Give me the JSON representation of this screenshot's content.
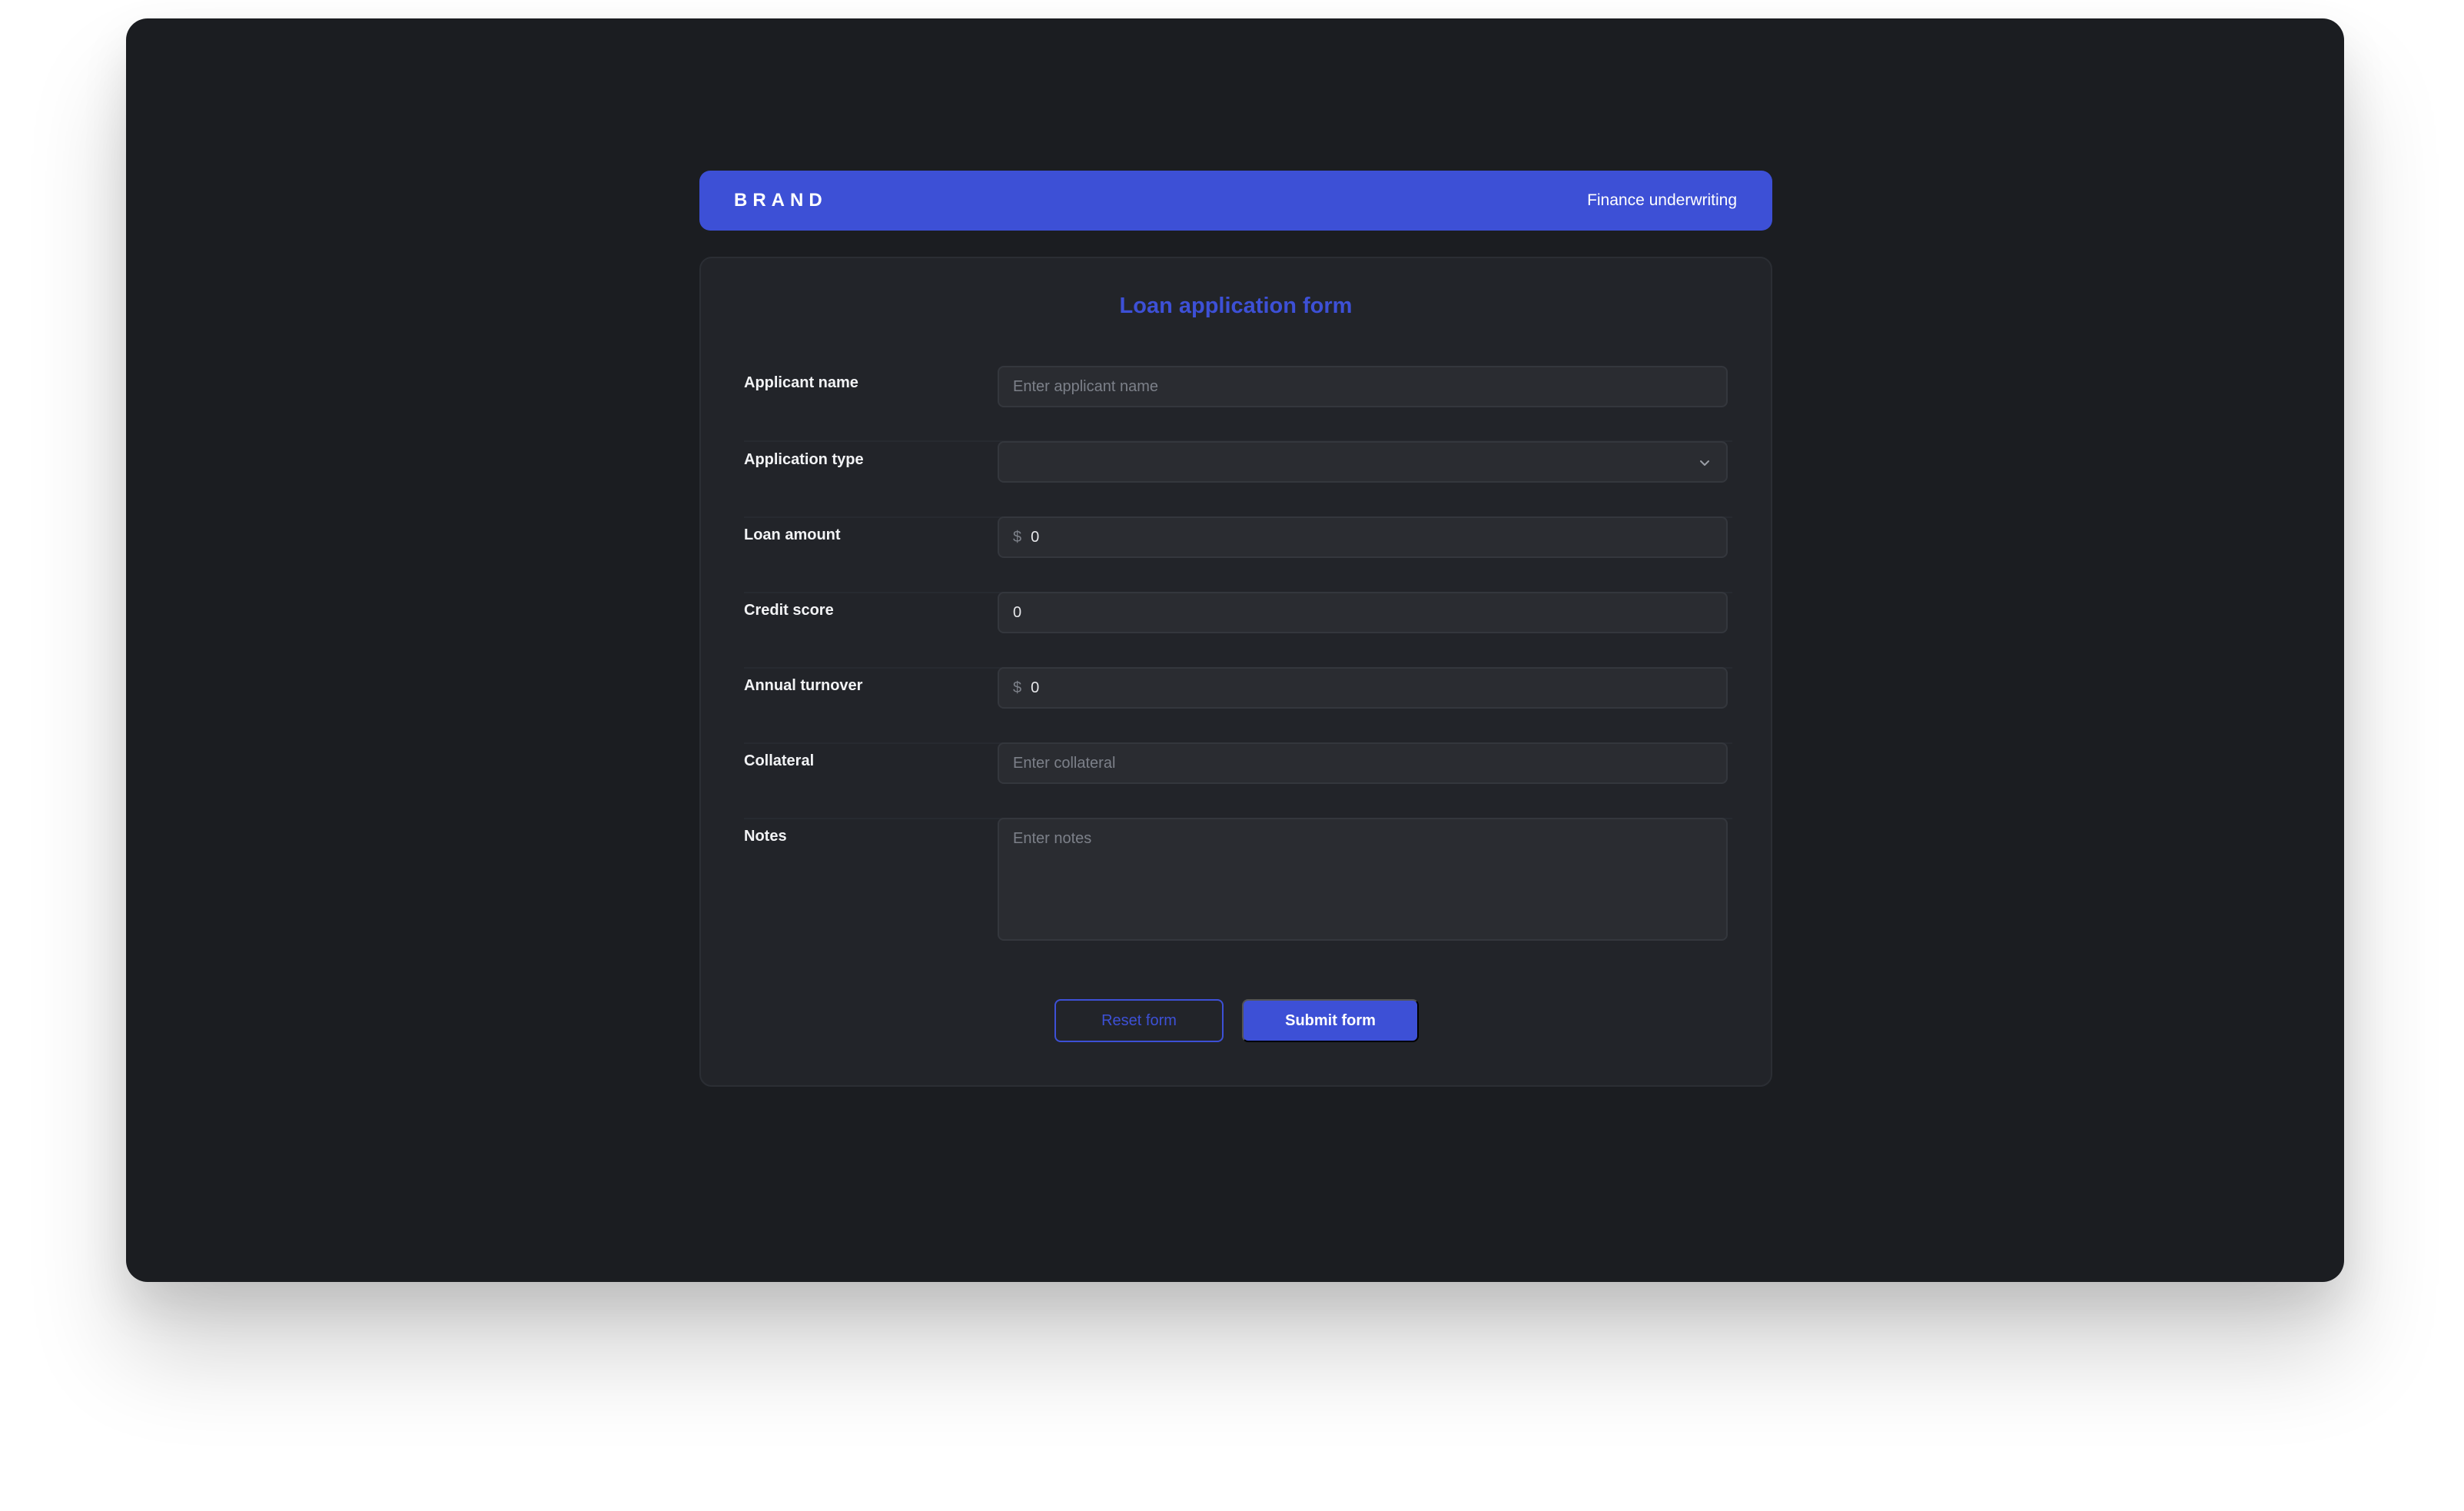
{
  "header": {
    "brand": "BRAND",
    "subtitle": "Finance underwriting"
  },
  "form": {
    "title": "Loan application form",
    "fields": {
      "applicant_name": {
        "label": "Applicant name",
        "placeholder": "Enter applicant name"
      },
      "application_type": {
        "label": "Application type",
        "value": ""
      },
      "loan_amount": {
        "label": "Loan amount",
        "prefix": "$",
        "value": "0"
      },
      "credit_score": {
        "label": "Credit score",
        "value": "0"
      },
      "annual_turnover": {
        "label": "Annual turnover",
        "prefix": "$",
        "value": "0"
      },
      "collateral": {
        "label": "Collateral",
        "placeholder": "Enter collateral"
      },
      "notes": {
        "label": "Notes",
        "placeholder": "Enter notes"
      }
    },
    "buttons": {
      "reset": "Reset form",
      "submit": "Submit form"
    }
  },
  "colors": {
    "accent": "#3d50d6",
    "window_bg": "#1b1d21",
    "card_bg": "#222429",
    "field_bg": "#2a2c31"
  },
  "icons": {
    "select_chevron": "chevron-down-icon"
  }
}
